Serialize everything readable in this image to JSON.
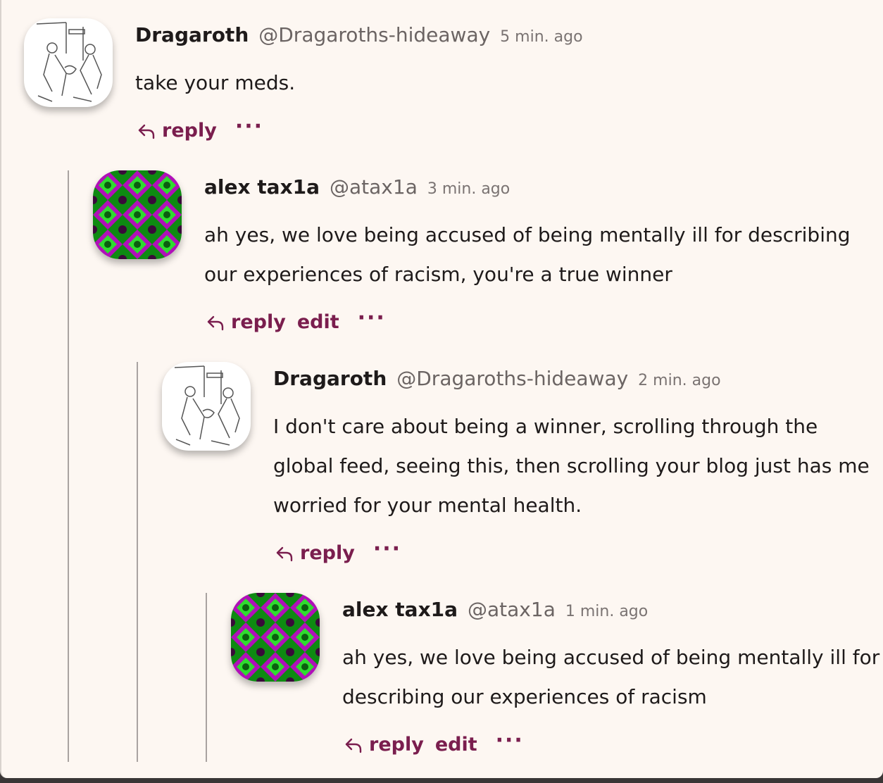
{
  "colors": {
    "background": "#fdf7f2",
    "text": "#1e1a1a",
    "muted": "#6b6463",
    "action": "#7a1e4e",
    "thread_line": "#a9a3a1"
  },
  "comments": [
    {
      "author": "Dragaroth",
      "handle": "@Dragaroths-hideaway",
      "time": "5 min. ago",
      "text": "take your meds.",
      "avatar": "sketch-avatar-icon",
      "actions": {
        "reply": "reply",
        "more": "···"
      }
    },
    {
      "author": "alex tax1a",
      "handle": "@atax1a",
      "time": "3 min. ago",
      "text": "ah yes, we love being accused of being mentally ill for describing our experiences of racism, you're a true winner",
      "avatar": "kaleidoscope-avatar-icon",
      "actions": {
        "reply": "reply",
        "edit": "edit",
        "more": "···"
      }
    },
    {
      "author": "Dragaroth",
      "handle": "@Dragaroths-hideaway",
      "time": "2 min. ago",
      "text": "I don't care about being a winner, scrolling through the global feed, seeing this, then scrolling your blog just has me worried for your mental health.",
      "avatar": "sketch-avatar-icon",
      "actions": {
        "reply": "reply",
        "more": "···"
      }
    },
    {
      "author": "alex tax1a",
      "handle": "@atax1a",
      "time": "1 min. ago",
      "text": "ah yes, we love being accused of being mentally ill for describing our experiences of racism",
      "avatar": "kaleidoscope-avatar-icon",
      "actions": {
        "reply": "reply",
        "edit": "edit",
        "more": "···"
      }
    }
  ]
}
